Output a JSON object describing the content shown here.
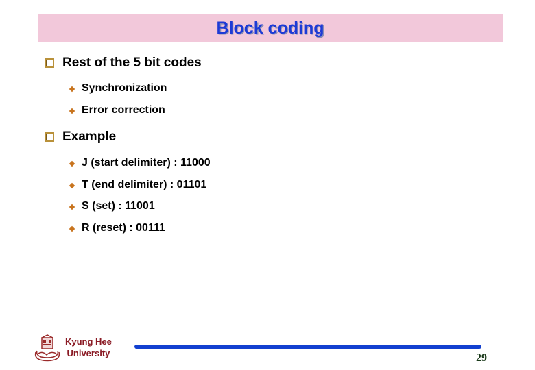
{
  "slide": {
    "title": "Block coding",
    "sections": [
      {
        "heading": "Rest of the 5 bit codes",
        "items": [
          "Synchronization",
          "Error correction"
        ]
      },
      {
        "heading": "Example",
        "items": [
          "J (start delimiter) : 11000",
          "T (end delimiter) : 01101",
          "S (set) : 11001",
          "R (reset) : 00111"
        ]
      }
    ]
  },
  "footer": {
    "university_line1": "Kyung Hee",
    "university_line2": "University",
    "page_number": "29",
    "logo_icon": "university-seal-icon"
  },
  "colors": {
    "title_bar_bg": "#f2c8da",
    "title_text": "#1d3ad6",
    "bullet_square": "#b9913a",
    "bullet_diamond": "#c8741e",
    "footer_line": "#1240d0",
    "university_text": "#8a1a24"
  }
}
